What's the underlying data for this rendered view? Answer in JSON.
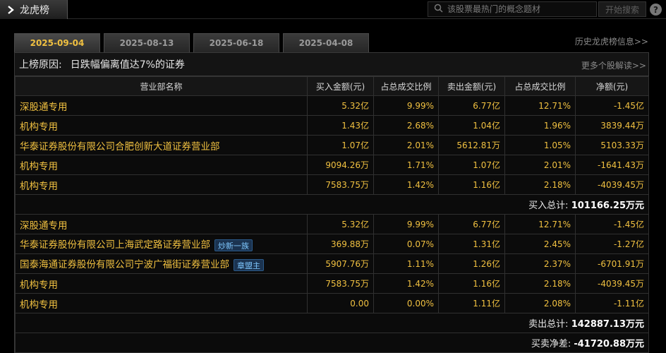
{
  "header": {
    "title": "龙虎榜",
    "search_placeholder": "该股票最热门的概念题材",
    "search_button": "开始搜索",
    "help_label": "?"
  },
  "tabs": [
    {
      "label": "2025-09-04",
      "active": true
    },
    {
      "label": "2025-08-13",
      "active": false
    },
    {
      "label": "2025-06-18",
      "active": false
    },
    {
      "label": "2025-04-08",
      "active": false
    }
  ],
  "history_link": "历史龙虎榜信息>>",
  "reason": {
    "label": "上榜原因:",
    "text": "日跌幅偏离值达7%的证券"
  },
  "more_link": "更多个股解读>>",
  "columns": [
    "营业部名称",
    "买入金额(元)",
    "占总成交比例",
    "卖出金额(元)",
    "占总成交比例",
    "净额(元)"
  ],
  "buy_rows": [
    {
      "name": "深股通专用",
      "buy": "5.32亿",
      "buy_pct": "9.99%",
      "sell": "6.77亿",
      "sell_pct": "12.71%",
      "net": "-1.45亿"
    },
    {
      "name": "机构专用",
      "buy": "1.43亿",
      "buy_pct": "2.68%",
      "sell": "1.04亿",
      "sell_pct": "1.96%",
      "net": "3839.44万"
    },
    {
      "name": "华泰证券股份有限公司合肥创新大道证券营业部",
      "buy": "1.07亿",
      "buy_pct": "2.01%",
      "sell": "5612.81万",
      "sell_pct": "1.05%",
      "net": "5103.33万"
    },
    {
      "name": "机构专用",
      "buy": "9094.26万",
      "buy_pct": "1.71%",
      "sell": "1.07亿",
      "sell_pct": "2.01%",
      "net": "-1641.43万"
    },
    {
      "name": "机构专用",
      "buy": "7583.75万",
      "buy_pct": "1.42%",
      "sell": "1.16亿",
      "sell_pct": "2.18%",
      "net": "-4039.45万"
    }
  ],
  "buy_total": {
    "label": "买入总计:",
    "value": "101166.25万元"
  },
  "sell_rows": [
    {
      "name": "深股通专用",
      "badge": "",
      "buy": "5.32亿",
      "buy_pct": "9.99%",
      "sell": "6.77亿",
      "sell_pct": "12.71%",
      "net": "-1.45亿"
    },
    {
      "name": "华泰证券股份有限公司上海武定路证券营业部",
      "badge": "炒新一族",
      "buy": "369.88万",
      "buy_pct": "0.07%",
      "sell": "1.31亿",
      "sell_pct": "2.45%",
      "net": "-1.27亿"
    },
    {
      "name": "国泰海通证券股份有限公司宁波广福街证券营业部",
      "badge": "章盟主",
      "buy": "5907.76万",
      "buy_pct": "1.11%",
      "sell": "1.26亿",
      "sell_pct": "2.37%",
      "net": "-6701.91万"
    },
    {
      "name": "机构专用",
      "badge": "",
      "buy": "7583.75万",
      "buy_pct": "1.42%",
      "sell": "1.16亿",
      "sell_pct": "2.18%",
      "net": "-4039.45万"
    },
    {
      "name": "机构专用",
      "badge": "",
      "buy": "0.00",
      "buy_pct": "0.00%",
      "sell": "1.11亿",
      "sell_pct": "2.08%",
      "net": "-1.11亿"
    }
  ],
  "sell_total": {
    "label": "卖出总计:",
    "value": "142887.13万元"
  },
  "net_total": {
    "label": "买卖净差:",
    "value": "-41720.88万元"
  },
  "colors": {
    "accent": "#f0c040",
    "badge_text": "#7fc8ff",
    "badge_bg": "#1b3350"
  }
}
